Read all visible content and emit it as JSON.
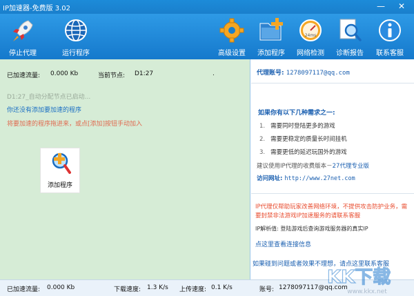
{
  "window": {
    "title": "IP加速器-免费版 3.02",
    "minimize": "—",
    "close": "✕"
  },
  "toolbar": {
    "stop_proxy": "停止代理",
    "run_program": "运行程序",
    "advanced": "高级设置",
    "add_program": "添加程序",
    "net_check": "网络检测",
    "diagnose": "诊断报告",
    "contact": "联系客服",
    "gauge_text": "24ms"
  },
  "left": {
    "traffic_label": "已加速流量:",
    "traffic_value": "0.000 Kb",
    "node_label": "当前节点:",
    "node_value": "D1:27",
    "node_dot": ".",
    "log1": "D1:27_自动分配节点已启动...",
    "log2": "你还没有添加要加速的程序",
    "log3": "将要加速的程序拖进来，或点[添加]按钮手动加入",
    "add_card_label": "添加程序"
  },
  "right": {
    "account_label": "代理账号:",
    "account_value": "1278097117@qq.com",
    "need_title": "如果你有以下几种需求之一:",
    "needs": [
      {
        "num": "1.",
        "text": "需要同时登陆更多的游戏"
      },
      {
        "num": "2.",
        "text": "需要更稳定的质量长时间挂机"
      },
      {
        "num": "3.",
        "text": "需要更低的延迟玩国外的游戏"
      }
    ],
    "suggest_text": "建议使用IP代理的收费版本－",
    "suggest_link": "27代理专业版",
    "site_label": "访问网址:",
    "site_value": "http://www.27net.com",
    "warning": "IP代理仅帮助玩家改善网络环境，不提供攻击防护业务，需要封禁非法游戏IP加速服务的请联系客服",
    "ip_tip": "IP解析值: 登陆游戏后查询游戏服务器的真实IP",
    "conn_link": "点这里查看连接信息",
    "help_link": "如果碰到问题或者效果不理想，请点这里联系客服"
  },
  "status": {
    "traffic_label": "已加速流量:",
    "traffic_value": "0.000 Kb",
    "download_label": "下载速度:",
    "download_value": "1.3 K/s",
    "upload_label": "上传速度:",
    "upload_value": "0.1 K/s",
    "account_label": "账号:",
    "account_value": "1278097117@qq.com"
  },
  "watermark": {
    "text": "KK下载",
    "url": "www.kkx.net"
  },
  "colors": {
    "toolbar": "#1a82d2",
    "left_bg": "#d6ecd6",
    "link_blue": "#1a5fb0",
    "warn_red": "#e84c2f"
  }
}
